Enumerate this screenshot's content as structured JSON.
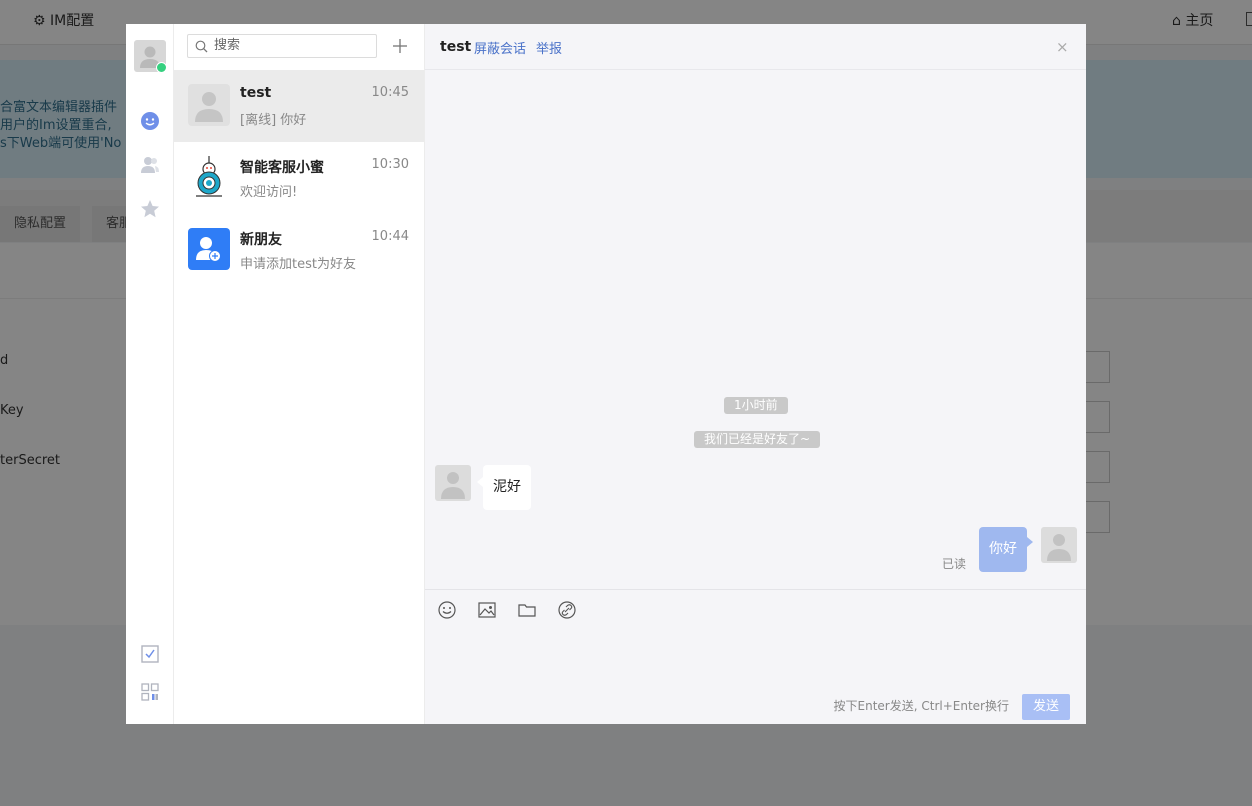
{
  "background": {
    "topbar_title": "IM配置",
    "home_link": "主页",
    "notice_lines": [
      "合富文本编辑器插件",
      "用户的Im设置重合,",
      "s下Web端可使用'No"
    ],
    "tabs": [
      "隐私配置",
      "客服"
    ],
    "field_labels": [
      "d",
      "Key",
      "terSecret"
    ]
  },
  "rail": {
    "icons": [
      "chat-icon",
      "contacts-icon",
      "favorites-icon",
      "checklist-icon",
      "apps-icon"
    ],
    "colors": {
      "active": "#6f8fe8",
      "inactive": "#c8ccd6",
      "online": "#35d07f"
    }
  },
  "conversation_list": {
    "search_placeholder": "搜索",
    "items": [
      {
        "name": "test",
        "time": "10:45",
        "preview": "[离线] 你好",
        "avatar": "default-avatar",
        "active": true
      },
      {
        "name": "智能客服小蜜",
        "time": "10:30",
        "preview": "欢迎访问!",
        "avatar": "robot-avatar",
        "active": false
      },
      {
        "name": "新朋友",
        "time": "10:44",
        "preview": "申请添加test为好友",
        "avatar": "new-friend-avatar",
        "active": false
      }
    ]
  },
  "chat": {
    "title": "test",
    "mute_link": "屏蔽会话",
    "report_link": "举报",
    "close_symbol": "×",
    "time_divider": "1小时前",
    "system_notice": "我们已经是好友了~",
    "messages": [
      {
        "direction": "in",
        "text": "泥好"
      },
      {
        "direction": "out",
        "text": "你好",
        "status": "已读"
      }
    ],
    "composer": {
      "tools": [
        "emoji-icon",
        "image-icon",
        "folder-icon",
        "link-icon"
      ],
      "hint": "按下Enter发送, Ctrl+Enter换行",
      "send_label": "发送"
    }
  }
}
